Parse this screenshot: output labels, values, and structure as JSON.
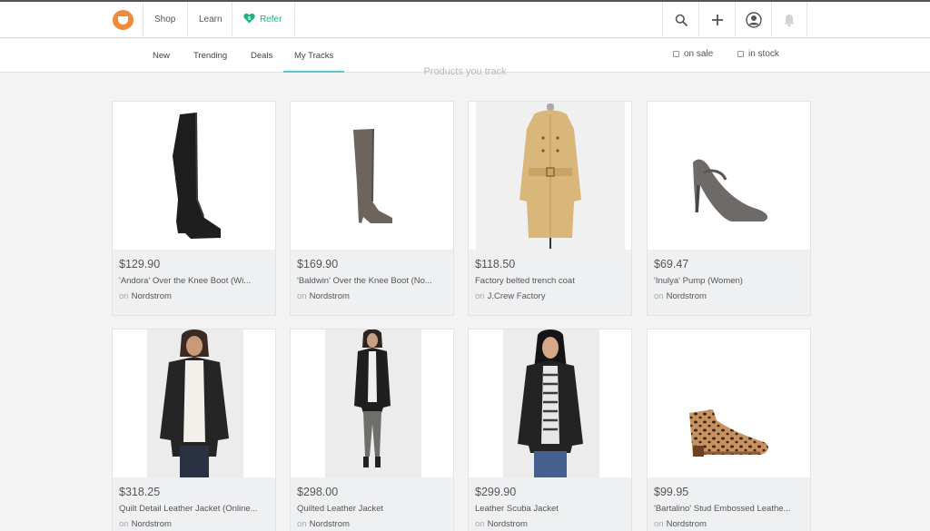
{
  "topnav": {
    "shop": "Shop",
    "learn": "Learn",
    "refer": "Refer",
    "icons": [
      "search-icon",
      "plus-icon",
      "user-icon",
      "bell-icon"
    ]
  },
  "tabs": [
    {
      "label": "New"
    },
    {
      "label": "Trending"
    },
    {
      "label": "Deals"
    },
    {
      "label": "My Tracks",
      "active": true
    }
  ],
  "filters": {
    "on_sale": "on sale",
    "in_stock": "in stock"
  },
  "section_title": "Products you track",
  "colors": {
    "brand": "#f18a3a",
    "refer": "#1fb27a",
    "active_tab": "#5ec7c9"
  },
  "products": [
    {
      "price": "$129.90",
      "title": "'Andora' Over the Knee Boot (Wi...",
      "on": "on",
      "store": "Nordstrom",
      "image": "black-over-knee-boot"
    },
    {
      "price": "$169.90",
      "title": "'Baldwin' Over the Knee Boot (No...",
      "on": "on",
      "store": "Nordstrom",
      "image": "grey-over-knee-boot"
    },
    {
      "price": "$118.50",
      "title": "Factory belted trench coat",
      "on": "on",
      "store": "J.Crew Factory",
      "image": "beige-trench-coat"
    },
    {
      "price": "$69.47",
      "title": "'Inulya' Pump (Women)",
      "on": "on",
      "store": "Nordstrom",
      "image": "grey-pump"
    },
    {
      "price": "$318.25",
      "title": "Quilt Detail Leather Jacket (Online...",
      "on": "on",
      "store": "Nordstrom",
      "image": "model-leather-jacket-white-sweater"
    },
    {
      "price": "$298.00",
      "title": "Quilted Leather Jacket",
      "on": "on",
      "store": "Nordstrom",
      "image": "model-quilted-leather-jacket"
    },
    {
      "price": "$299.90",
      "title": "Leather Scuba Jacket",
      "on": "on",
      "store": "Nordstrom",
      "image": "model-leather-scuba-jacket"
    },
    {
      "price": "$99.95",
      "title": "'Bartalino' Stud Embossed Leathe...",
      "on": "on",
      "store": "Nordstrom",
      "image": "leopard-ankle-boot"
    }
  ]
}
